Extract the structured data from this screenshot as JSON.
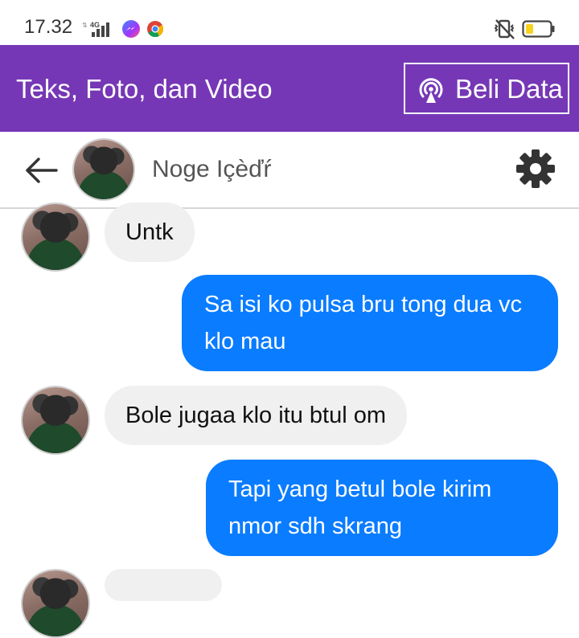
{
  "status_bar": {
    "time": "17.32",
    "network": "4G",
    "icons": [
      "signal-icon",
      "messenger-icon",
      "chrome-icon",
      "vibrate-off-icon",
      "battery-icon"
    ]
  },
  "banner": {
    "text": "Teks, Foto, dan Video",
    "button_label": "Beli Data",
    "button_icon": "broadcast-icon",
    "background": "#7637b6"
  },
  "header": {
    "contact_name": "Noge Içèďŕ",
    "back_icon": "arrow-left-icon",
    "settings_icon": "gear-icon"
  },
  "messages": [
    {
      "direction": "incoming",
      "text": "Untk"
    },
    {
      "direction": "outgoing",
      "text": "Sa isi ko pulsa bru tong dua vc klo mau"
    },
    {
      "direction": "incoming",
      "text": "Bole jugaa klo itu btul om"
    },
    {
      "direction": "outgoing",
      "text": "Tapi yang betul bole kirim nmor sdh skrang"
    }
  ],
  "colors": {
    "outgoing_bubble": "#0a7cff",
    "incoming_bubble": "#f0f0f0"
  }
}
